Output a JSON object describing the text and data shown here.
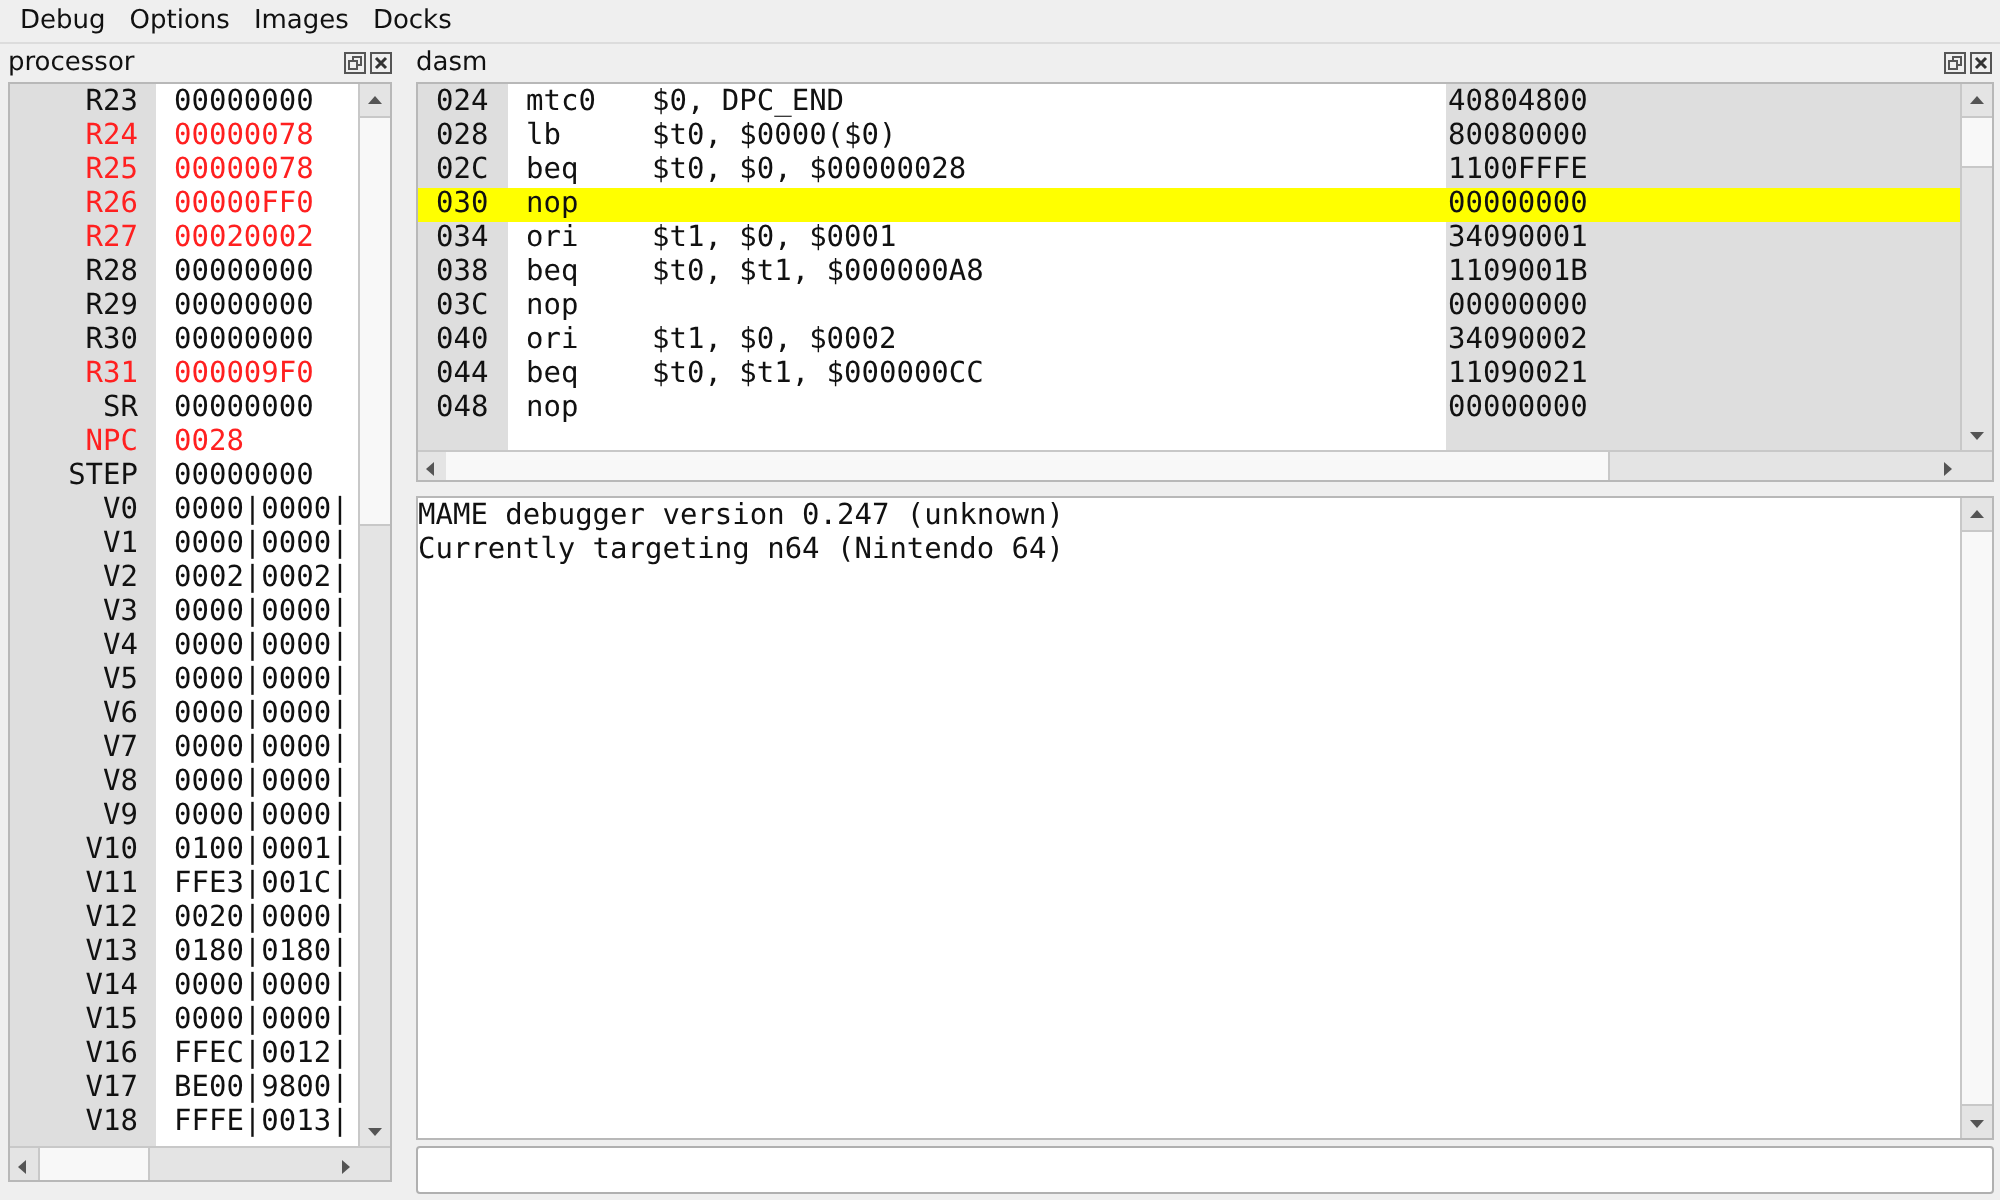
{
  "menu": [
    "Debug",
    "Options",
    "Images",
    "Docks"
  ],
  "processor": {
    "title": "processor",
    "registers": [
      {
        "name": "R23",
        "value": "00000000",
        "changed": false
      },
      {
        "name": "R24",
        "value": "00000078",
        "changed": true
      },
      {
        "name": "R25",
        "value": "00000078",
        "changed": true
      },
      {
        "name": "R26",
        "value": "00000FF0",
        "changed": true
      },
      {
        "name": "R27",
        "value": "00020002",
        "changed": true
      },
      {
        "name": "R28",
        "value": "00000000",
        "changed": false
      },
      {
        "name": "R29",
        "value": "00000000",
        "changed": false
      },
      {
        "name": "R30",
        "value": "00000000",
        "changed": false
      },
      {
        "name": "R31",
        "value": "000009F0",
        "changed": true
      },
      {
        "name": "SR",
        "value": "00000000",
        "changed": false
      },
      {
        "name": "NPC",
        "value": "0028",
        "changed": true
      },
      {
        "name": "STEP",
        "value": "00000000",
        "changed": false
      },
      {
        "name": "V0",
        "value": "0000|0000|",
        "changed": false
      },
      {
        "name": "V1",
        "value": "0000|0000|",
        "changed": false
      },
      {
        "name": "V2",
        "value": "0002|0002|",
        "changed": false
      },
      {
        "name": "V3",
        "value": "0000|0000|",
        "changed": false
      },
      {
        "name": "V4",
        "value": "0000|0000|",
        "changed": false
      },
      {
        "name": "V5",
        "value": "0000|0000|",
        "changed": false
      },
      {
        "name": "V6",
        "value": "0000|0000|",
        "changed": false
      },
      {
        "name": "V7",
        "value": "0000|0000|",
        "changed": false
      },
      {
        "name": "V8",
        "value": "0000|0000|",
        "changed": false
      },
      {
        "name": "V9",
        "value": "0000|0000|",
        "changed": false
      },
      {
        "name": "V10",
        "value": "0100|0001|",
        "changed": false
      },
      {
        "name": "V11",
        "value": "FFE3|001C|",
        "changed": false
      },
      {
        "name": "V12",
        "value": "0020|0000|",
        "changed": false
      },
      {
        "name": "V13",
        "value": "0180|0180|",
        "changed": false
      },
      {
        "name": "V14",
        "value": "0000|0000|",
        "changed": false
      },
      {
        "name": "V15",
        "value": "0000|0000|",
        "changed": false
      },
      {
        "name": "V16",
        "value": "FFEC|0012|",
        "changed": false
      },
      {
        "name": "V17",
        "value": "BE00|9800|",
        "changed": false
      },
      {
        "name": "V18",
        "value": "FFFE|0013|",
        "changed": false
      }
    ]
  },
  "dasm": {
    "title": "dasm",
    "rows": [
      {
        "address": "024",
        "mnemonic": "mtc0",
        "operands": "$0, DPC_END",
        "opcode": "40804800",
        "selected": false
      },
      {
        "address": "028",
        "mnemonic": "lb",
        "operands": "$t0, $0000($0)",
        "opcode": "80080000",
        "selected": false
      },
      {
        "address": "02C",
        "mnemonic": "beq",
        "operands": "$t0, $0, $00000028",
        "opcode": "1100FFFE",
        "selected": false
      },
      {
        "address": "030",
        "mnemonic": "nop",
        "operands": "",
        "opcode": "00000000",
        "selected": true
      },
      {
        "address": "034",
        "mnemonic": "ori",
        "operands": "$t1, $0, $0001",
        "opcode": "34090001",
        "selected": false
      },
      {
        "address": "038",
        "mnemonic": "beq",
        "operands": "$t0, $t1, $000000A8",
        "opcode": "1109001B",
        "selected": false
      },
      {
        "address": "03C",
        "mnemonic": "nop",
        "operands": "",
        "opcode": "00000000",
        "selected": false
      },
      {
        "address": "040",
        "mnemonic": "ori",
        "operands": "$t1, $0, $0002",
        "opcode": "34090002",
        "selected": false
      },
      {
        "address": "044",
        "mnemonic": "beq",
        "operands": "$t0, $t1, $000000CC",
        "opcode": "11090021",
        "selected": false
      },
      {
        "address": "048",
        "mnemonic": "nop",
        "operands": "",
        "opcode": "00000000",
        "selected": false
      }
    ]
  },
  "console": {
    "lines": [
      "MAME debugger version 0.247 (unknown)",
      "Currently targeting n64 (Nintendo 64)"
    ]
  }
}
